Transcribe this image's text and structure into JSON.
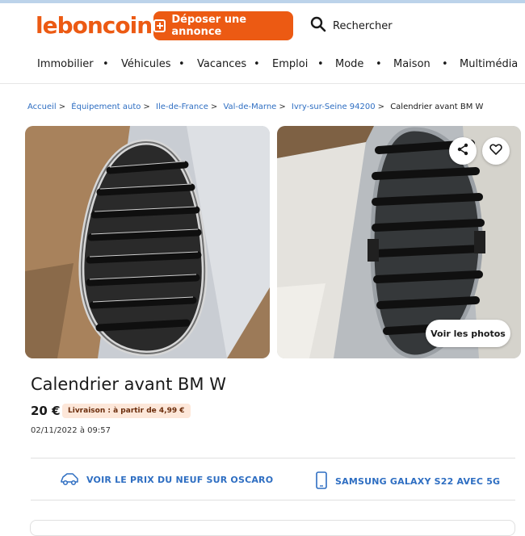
{
  "header": {
    "logo": "leboncoin",
    "post_button": "Déposer une annonce",
    "search_label": "Rechercher"
  },
  "nav": {
    "items": [
      "Immobilier",
      "Véhicules",
      "Vacances",
      "Emploi",
      "Mode",
      "Maison",
      "Multimédia"
    ],
    "separator": "•"
  },
  "breadcrumb": {
    "links": [
      "Accueil",
      "Équipement auto",
      "Ile-de-France",
      "Val-de-Marne",
      "Ivry-sur-Seine 94200"
    ],
    "separator": ">",
    "current": "Calendrier avant BM W"
  },
  "gallery": {
    "see_photos": "Voir les photos"
  },
  "listing": {
    "title": "Calendrier avant BM W",
    "price": "20 €",
    "delivery": "Livraison : à partir de 4,99 €",
    "date": "02/11/2022 à 09:57"
  },
  "promos": [
    {
      "label": "VOIR LE PRIX DU NEUF SUR OSCARO",
      "icon": "car-icon"
    },
    {
      "label": "SAMSUNG GALAXY S22 AVEC 5G",
      "icon": "smartphone-icon"
    }
  ],
  "colors": {
    "brand": "#ec5a13",
    "link": "#2e6ec2",
    "badge_bg": "#fde7d9"
  }
}
